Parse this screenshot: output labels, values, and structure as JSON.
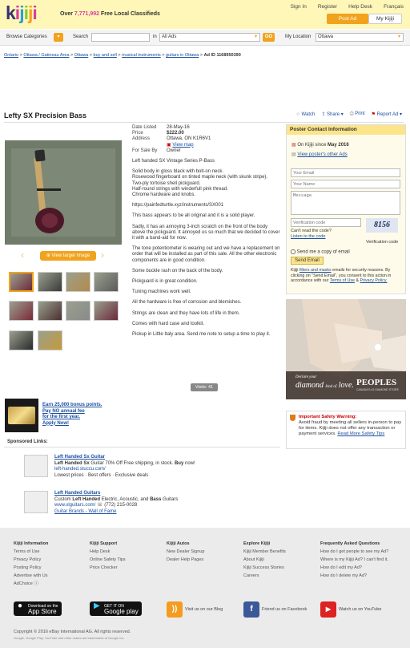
{
  "header": {
    "logo_letters": [
      "k",
      "i",
      "j",
      "i",
      "j",
      "i"
    ],
    "logo_colors": [
      "#373373",
      "#d63e9e",
      "#2aa0d6",
      "#8cc63f",
      "#f1a31d",
      "#d63e9e"
    ],
    "tagline_prefix": "Over",
    "tagline_count": "7,771,992",
    "tagline_suffix": "Free Local Classifieds",
    "links": [
      "Sign In",
      "Register",
      "Help Desk",
      "Français"
    ],
    "post_ad": "Post Ad",
    "my_kijiji": "My Kijiji"
  },
  "search": {
    "browse_label": "Browse Categories",
    "search_label": "Search",
    "search_value": "",
    "in_label": "in",
    "in_value": "All Ads",
    "go_label": "GO",
    "location_label": "My Location",
    "location_value": "Ottawa"
  },
  "breadcrumb": [
    "Ontario",
    "Ottawa / Gatineau Area",
    "Ottawa",
    "buy and sell",
    "musical instruments",
    "guitars in Ottawa"
  ],
  "ad_id_label": "Ad ID 1168950390",
  "title": "Lefty SX Precision Bass",
  "actions": {
    "watch": "Watch",
    "share": "Share",
    "print": "Print",
    "report": "Report Ad"
  },
  "details": {
    "date_key": "Date Listed",
    "date_val": "28-May-16",
    "price_key": "Price",
    "price_val": "$222.00",
    "addr_key": "Address",
    "addr_val": "Ottawa, ON K1R6V1",
    "map_link": "View map",
    "forsale_key": "For Sale By",
    "forsale_val": "Owner"
  },
  "description": [
    "Left handed SX Vintage Series P-Bass",
    "Solid body in gloss black with bolt-on neck.\nRosewood fingerboard on tinted maple neck (with skunk stripe).\nTwo-ply tortoise shell pickguard.\nHalf-round strings with winderfull pink thread.\nChrome hardware and knobs.",
    "https://painfedturtle.xyz/instruments/SX001",
    "This bass appears to be all original and it is a solid player.",
    "Sadly, it has an annoying 3-inch scratch on the front of the body above the pickguard. It annoyed us so much that we decided to cover it with a band-aid for now.",
    "The tone potentiometer is wearing out and we have a replacement on order that will be installed as part of this sale. All the other electronic components are in good condition.",
    "Some buckle rash on the back of the body.",
    "Pickguard is in great condition.",
    "Tuning machines work well.",
    "All the hardware is free of corrosion and blemishes.",
    "Strings are clean and they have lots of life in them.",
    "Comes with hard case and toolkit.",
    "Pickup in Little Italy area. Send me note to setup a time to play it."
  ],
  "visits": "Visits: 41",
  "gallery": {
    "view_larger": "View larger image",
    "thumb_count": 10
  },
  "contact": {
    "heading": "Poster Contact Information",
    "since_prefix": "On Kijiji since",
    "since_date": "May 2016",
    "other_ads": "View poster's other Ads",
    "email_ph": "Your Email",
    "name_ph": "Your Name",
    "msg_ph": "Message",
    "code_ph": "Verification code",
    "cant_read": "Can't read the code?",
    "listen": "Listen to the code",
    "captcha": "8156",
    "verif_label": "Verification code",
    "copy_label": "Send me a copy of email",
    "send": "Send Email",
    "legal_1": "Kijiji",
    "legal_link1": "filters and masks",
    "legal_2": "emails for security reasons. By clicking on \"Send Email\", you consent to this action in accordance with our",
    "legal_link2": "Terms of Use",
    "legal_3": "&",
    "legal_link3": "Privacy Policy."
  },
  "ad_banner": {
    "line1": "Declare your",
    "line2": "diamond",
    "line3": "kind of",
    "line4": "love.",
    "brand": "PEOPLES",
    "brand_sub": "CANADA'S #1 DIAMOND STORE"
  },
  "safety": {
    "title": "Important Safety Warning:",
    "text": "Avoid fraud by meeting all sellers in-person to pay for items. Kijiji does not offer any transaction or payment services.",
    "link": "Read More Safety Tips"
  },
  "promo": {
    "l1": "Earn 25,000 bonus points.",
    "l2": "Pay NO annual fee",
    "l3": "for the first year.",
    "l4": "Apply Now!"
  },
  "sponsored": {
    "label": "Sponsored Links:",
    "items": [
      {
        "title": "Left Handed Sx Guitar",
        "desc_b": "Left Handed Sx",
        "desc": "Guitar 70% Off Free shipping, in stock.",
        "desc_b2": "Buy",
        "desc_end": "now!",
        "url": "left-handed.stuccu.com/",
        "extra": "Lowest prices · Best offers · Exclusive deals"
      },
      {
        "title": "Left Handed Guitars",
        "desc_pre": "Custom",
        "desc_b": "Left Handed",
        "desc": "Electric, Acoustic, and",
        "desc_b2": "Bass",
        "desc_end": "Guitars",
        "url": "www.xlguitars.com/",
        "phone": "(772) 215-0028",
        "extra": "Guitar Brands - Wall of Fame"
      }
    ]
  },
  "footer": {
    "cols": [
      {
        "h": "Kijiji Information",
        "items": [
          "Terms of Use",
          "Privacy Policy",
          "Posting Policy",
          "Advertise with Us",
          "AdChoice ⓘ"
        ]
      },
      {
        "h": "Kijiji Support",
        "items": [
          "Help Desk",
          "Online Safety Tips",
          "Price Checker"
        ]
      },
      {
        "h": "Kijiji Autos",
        "items": [
          "New Dealer Signup",
          "Dealer Help Pages"
        ]
      },
      {
        "h": "Explore Kijiji",
        "items": [
          "Kijiji Member Benefits",
          "About Kijiji",
          "Kijiji Success Stories",
          "Careers"
        ]
      },
      {
        "h": "Frequently Asked Questions",
        "items": [
          "How do I get people to see my Ad?",
          "Where is my Kijiji Ad? I can't find it.",
          "How do I edit my Ad?",
          "How do I delete my Ad?"
        ]
      }
    ],
    "appstore_top": "Download on the",
    "appstore": "App Store",
    "gplay_top": "GET IT ON",
    "gplay": "Google play",
    "blog": "Visit us on our Blog",
    "facebook": "Friend us on Facebook",
    "youtube": "Watch us on YouTube",
    "copyright": "Copyright © 2016 eBay International AG. All rights reserved.",
    "trademarks": "Google, Google Play, YouTube and other marks are trademarks of Google Inc."
  }
}
